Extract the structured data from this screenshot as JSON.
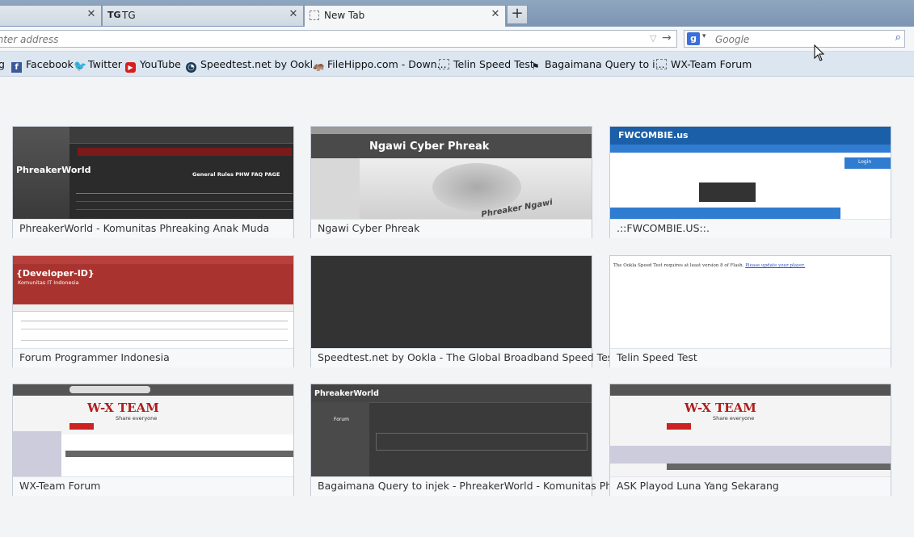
{
  "tabs": [
    {
      "label": "",
      "favicon": "blank",
      "selected": false
    },
    {
      "label": "TG",
      "favicon": "TG",
      "selected": false
    },
    {
      "label": "New Tab",
      "favicon": "blank",
      "selected": true
    }
  ],
  "navbar": {
    "url_placeholder": "Enter address",
    "search_placeholder": "Google",
    "search_engine_icon": "g"
  },
  "bookmarks": [
    {
      "label": "Facebook",
      "icon": "facebook-icon"
    },
    {
      "label": "Twitter",
      "icon": "twitter-icon"
    },
    {
      "label": "YouTube",
      "icon": "youtube-icon"
    },
    {
      "label": "Speedtest.net by Ookl...",
      "icon": "speedtest-icon"
    },
    {
      "label": "FileHippo.com - Down...",
      "icon": "filehippo-icon"
    },
    {
      "label": "Telin Speed Test",
      "icon": "blank-page-icon"
    },
    {
      "label": "Bagaimana Query to i...",
      "icon": "flag-icon"
    },
    {
      "label": "WX-Team Forum",
      "icon": "blank-page-icon"
    }
  ],
  "tiles": [
    {
      "caption": "PhreakerWorld - Komunitas Phreaking Anak Muda",
      "thumb_text": "PhreakerWorld",
      "thumb_sub": "General Rules PHW   FAQ PAGE"
    },
    {
      "caption": "Ngawi Cyber Phreak",
      "thumb_text": "Ngawi Cyber Phreak",
      "thumb_sub": "Phreaker Ngawi"
    },
    {
      "caption": ".::FWCOMBIE.US::.",
      "thumb_text": "FWCOMBIE.us",
      "thumb_sub": "Login"
    },
    {
      "caption": "Forum Programmer Indonesia",
      "thumb_text": "{Developer-ID}",
      "thumb_sub": "Komunitas IT Indonesia"
    },
    {
      "caption": "Speedtest.net by Ookla - The Global Broadband Speed Test",
      "thumb_text": "",
      "thumb_sub": ""
    },
    {
      "caption": "Telin Speed Test",
      "thumb_text": "The Ookla Speed Test requires at least version 8 of Flash.",
      "thumb_sub": "Please update your player."
    },
    {
      "caption": "WX-Team Forum",
      "thumb_text": "W-X TEAM",
      "thumb_sub": "Share everyone"
    },
    {
      "caption": "Bagaimana Query to injek - PhreakerWorld - Komunitas Phre...",
      "thumb_text": "PhreakerWorld",
      "thumb_sub": "Forum"
    },
    {
      "caption": "ASK Playod Luna Yang Sekarang",
      "thumb_text": "W-X TEAM",
      "thumb_sub": "Share everyone"
    }
  ]
}
